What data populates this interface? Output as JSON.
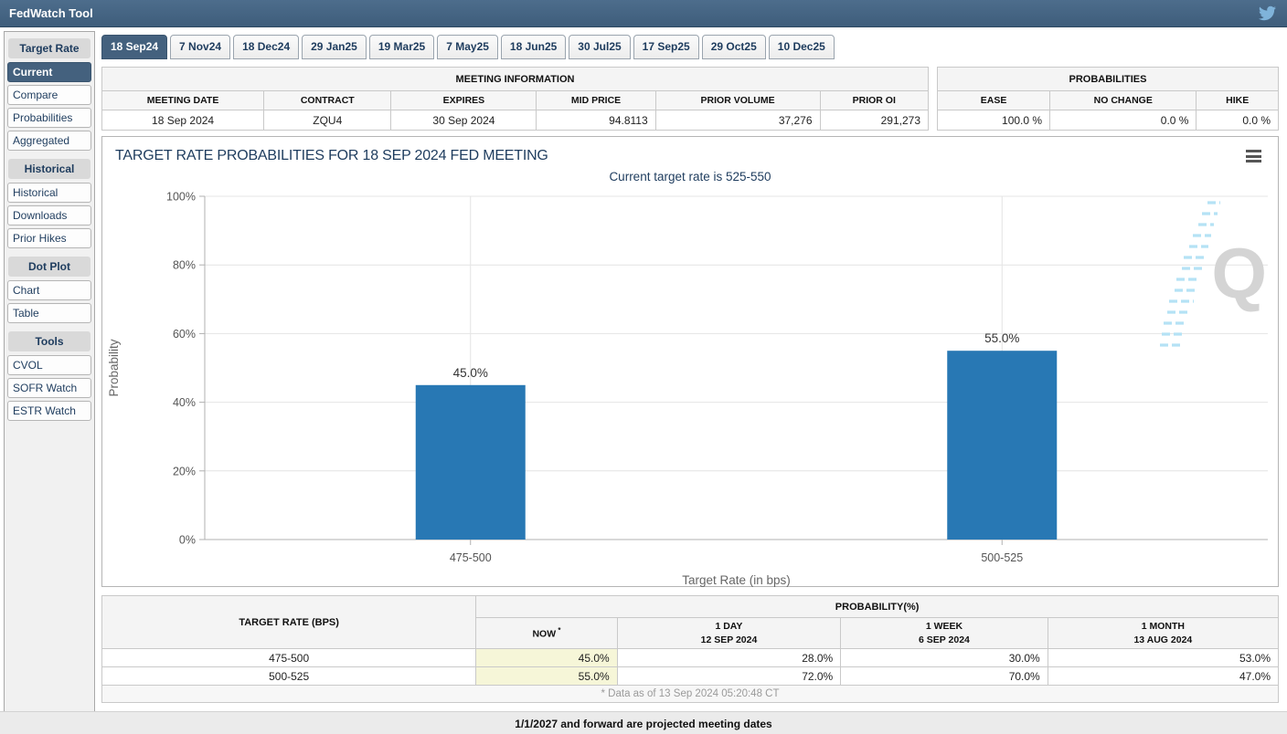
{
  "titlebar": {
    "title": "FedWatch Tool"
  },
  "sidebar": {
    "groups": [
      {
        "header": "Target Rate",
        "active": "Current",
        "items": [
          "Current",
          "Compare",
          "Probabilities",
          "Aggregated"
        ]
      },
      {
        "header": "Historical",
        "items": [
          "Historical",
          "Downloads",
          "Prior Hikes"
        ]
      },
      {
        "header": "Dot Plot",
        "items": [
          "Chart",
          "Table"
        ]
      },
      {
        "header": "Tools",
        "items": [
          "CVOL",
          "SOFR Watch",
          "ESTR Watch"
        ]
      }
    ]
  },
  "tabs": [
    "18 Sep24",
    "7 Nov24",
    "18 Dec24",
    "29 Jan25",
    "19 Mar25",
    "7 May25",
    "18 Jun25",
    "30 Jul25",
    "17 Sep25",
    "29 Oct25",
    "10 Dec25"
  ],
  "active_tab": "18 Sep24",
  "meeting_info": {
    "title": "MEETING INFORMATION",
    "headers": [
      "MEETING DATE",
      "CONTRACT",
      "EXPIRES",
      "MID PRICE",
      "PRIOR VOLUME",
      "PRIOR OI"
    ],
    "values": [
      "18 Sep 2024",
      "ZQU4",
      "30 Sep 2024",
      "94.8113",
      "37,276",
      "291,273"
    ]
  },
  "probabilities": {
    "title": "PROBABILITIES",
    "headers": [
      "EASE",
      "NO CHANGE",
      "HIKE"
    ],
    "values": [
      "100.0 %",
      "0.0 %",
      "0.0 %"
    ]
  },
  "chart_data": {
    "type": "bar",
    "title": "TARGET RATE PROBABILITIES FOR 18 SEP 2024 FED MEETING",
    "subtitle": "Current target rate is 525-550",
    "categories": [
      "475-500",
      "500-525"
    ],
    "values": [
      45.0,
      55.0
    ],
    "value_labels": [
      "45.0%",
      "55.0%"
    ],
    "xlabel": "Target Rate (in bps)",
    "ylabel": "Probability",
    "ylim": [
      0,
      100
    ],
    "yticks": [
      0,
      20,
      40,
      60,
      80,
      100
    ],
    "ytick_labels": [
      "0%",
      "20%",
      "40%",
      "60%",
      "80%",
      "100%"
    ],
    "bar_color": "#2878b4",
    "grid": true,
    "legend": false
  },
  "prob_table": {
    "rate_header": "TARGET RATE (BPS)",
    "group_header": "PROBABILITY(%)",
    "col_headers": [
      {
        "line1": "NOW",
        "sup": "*"
      },
      {
        "line1": "1 DAY",
        "line2": "12 SEP 2024"
      },
      {
        "line1": "1 WEEK",
        "line2": "6 SEP 2024"
      },
      {
        "line1": "1 MONTH",
        "line2": "13 AUG 2024"
      }
    ],
    "rows": [
      {
        "rate": "475-500",
        "now": "45.0%",
        "day": "28.0%",
        "week": "30.0%",
        "month": "53.0%"
      },
      {
        "rate": "500-525",
        "now": "55.0%",
        "day": "72.0%",
        "week": "70.0%",
        "month": "47.0%"
      }
    ],
    "footnote": "* Data as of 13 Sep 2024 05:20:48 CT"
  },
  "footer": {
    "note": "1/1/2027 and forward are projected meeting dates"
  },
  "colors": {
    "accent": "#44617e",
    "bar": "#2878b4",
    "now_highlight": "#f6f6d8",
    "titlebar": "#3e5d7b",
    "twitter": "#7fb3da"
  }
}
